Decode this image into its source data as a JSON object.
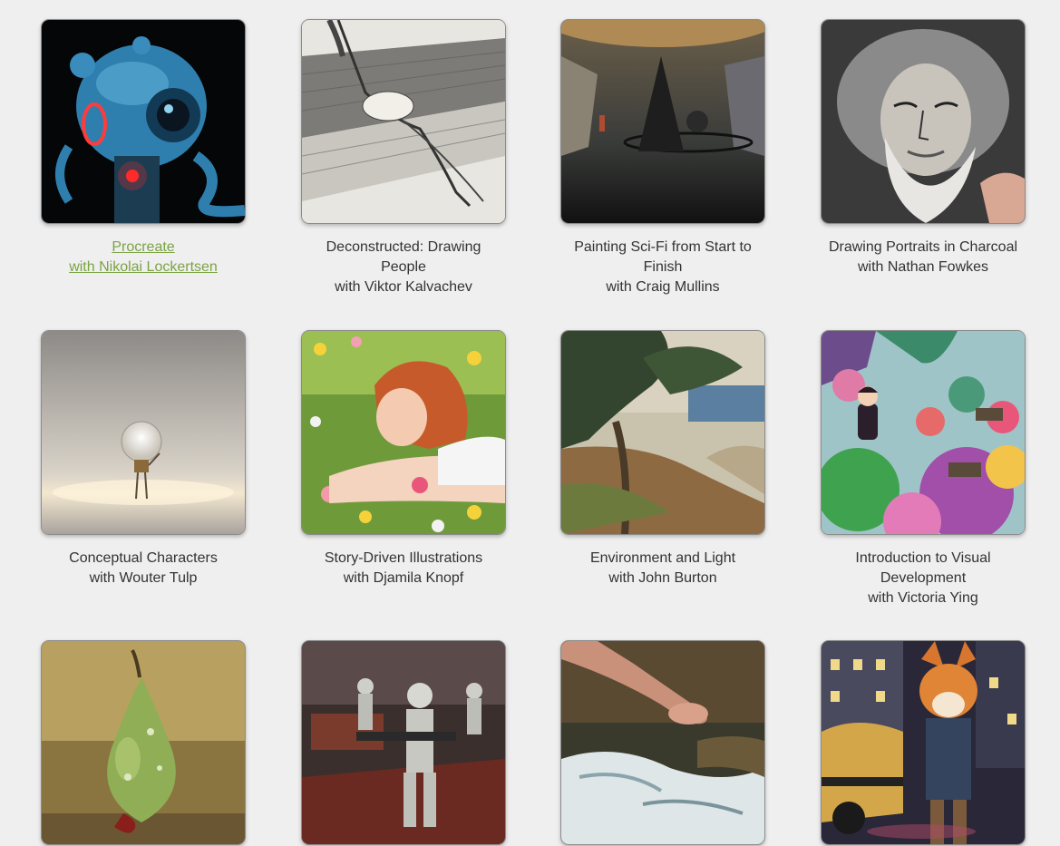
{
  "courses": [
    {
      "title": "Procreate",
      "instructor": "with Nikolai Lockertsen",
      "active": true,
      "art": "robot"
    },
    {
      "title": "Deconstructed: Drawing People",
      "instructor": "with Viktor Kalvachev",
      "active": false,
      "art": "figure-sketch"
    },
    {
      "title": "Painting Sci-Fi from Start to Finish",
      "instructor": "with Craig Mullins",
      "active": false,
      "art": "scifi-cone"
    },
    {
      "title": "Drawing Portraits in Charcoal",
      "instructor": "with Nathan Fowkes",
      "active": false,
      "art": "charcoal-portrait"
    },
    {
      "title": "Conceptual Characters",
      "instructor": "with Wouter Tulp",
      "active": false,
      "art": "lightbulb"
    },
    {
      "title": "Story-Driven Illustrations",
      "instructor": "with Djamila Knopf",
      "active": false,
      "art": "flower-girl"
    },
    {
      "title": "Environment and Light",
      "instructor": "with John Burton",
      "active": false,
      "art": "coast-trees"
    },
    {
      "title": "Introduction to Visual Development",
      "instructor": "with Victoria Ying",
      "active": false,
      "art": "candy-world"
    },
    {
      "title": "",
      "instructor": "",
      "active": false,
      "art": "pear"
    },
    {
      "title": "",
      "instructor": "",
      "active": false,
      "art": "stormtrooper"
    },
    {
      "title": "",
      "instructor": "",
      "active": false,
      "art": "foot-water"
    },
    {
      "title": "",
      "instructor": "",
      "active": false,
      "art": "fox-city"
    }
  ],
  "colors": {
    "background": "#efefef",
    "caption_text": "#333333",
    "active_link": "#7ba344"
  }
}
